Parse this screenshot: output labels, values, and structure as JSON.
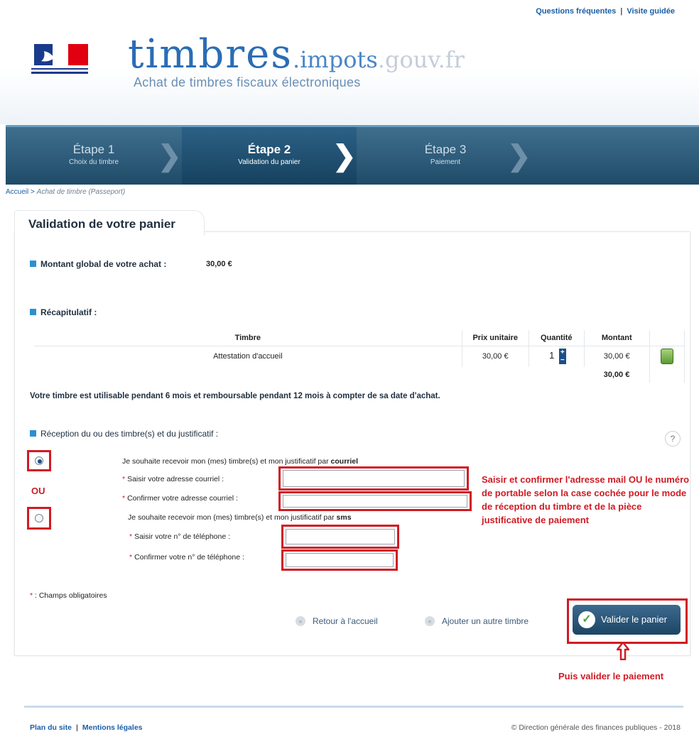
{
  "top_links": {
    "faq": "Questions fréquentes",
    "separator": "|",
    "tour": "Visite guidée"
  },
  "header": {
    "logo_main": "timbres",
    "logo_domain_1": ".impots",
    "logo_domain_2": ".gouv.fr",
    "subtitle": "Achat de timbres fiscaux électroniques"
  },
  "steps": [
    {
      "label": "Étape 1",
      "sub": "Choix du timbre"
    },
    {
      "label": "Étape 2",
      "sub": "Validation du panier"
    },
    {
      "label": "Étape 3",
      "sub": "Paiement"
    }
  ],
  "breadcrumb": {
    "home": "Accueil",
    "separator": ">",
    "current": "Achat de timbre (Passeport)"
  },
  "panel": {
    "title": "Validation de votre panier",
    "montant_label": "Montant global de votre achat :",
    "montant_value": "30,00 €",
    "recap_label": "Récapitulatif :"
  },
  "table": {
    "headers": [
      "Timbre",
      "Prix unitaire",
      "Quantité",
      "Montant"
    ],
    "row": {
      "timbre": "Attestation d'accueil",
      "prix": "30,00 €",
      "quantite": "1",
      "montant": "30,00 €"
    },
    "total": "30,00 €",
    "qty_plus": "+",
    "qty_minus": "−"
  },
  "validity_note": "Votre timbre est utilisable pendant 6 mois et remboursable pendant 12 mois à compter de sa date d'achat.",
  "reception": {
    "label": "Réception du ou des timbre(s) et du justificatif :",
    "help": "?",
    "ou": "OU",
    "mail_option": "Je souhaite recevoir mon (mes) timbre(s) et mon justificatif par",
    "mail_word": "courriel",
    "mail_field_1": "Saisir votre adresse courriel :",
    "mail_field_2": "Confirmer votre adresse courriel :",
    "sms_option": "Je souhaite recevoir mon (mes) timbre(s) et mon justificatif par",
    "sms_word": "sms",
    "phone_field_1": "Saisir votre n° de téléphone :",
    "phone_field_2": "Confirmer votre n° de téléphone :",
    "required_mark": "*"
  },
  "annotation": "Saisir et confirmer l'adresse mail OU le numéro de portable selon la case cochée pour le mode de réception du timbre et de la pièce justificative de paiement",
  "required_note": ": Champs obligatoires",
  "buttons": {
    "back_home": "Retour à l'accueil",
    "add_other": "Ajouter un autre timbre",
    "validate": "Valider le panier"
  },
  "annotation_2": "Puis valider le paiement",
  "footer": {
    "plan": "Plan du site",
    "separator": "|",
    "legal": "Mentions légales",
    "copyright": "© Direction générale des finances publiques - 2018"
  },
  "colors": {
    "accent": "#2a6db5",
    "steps_bar": "#1f4b68",
    "annotation": "#d01b24"
  }
}
